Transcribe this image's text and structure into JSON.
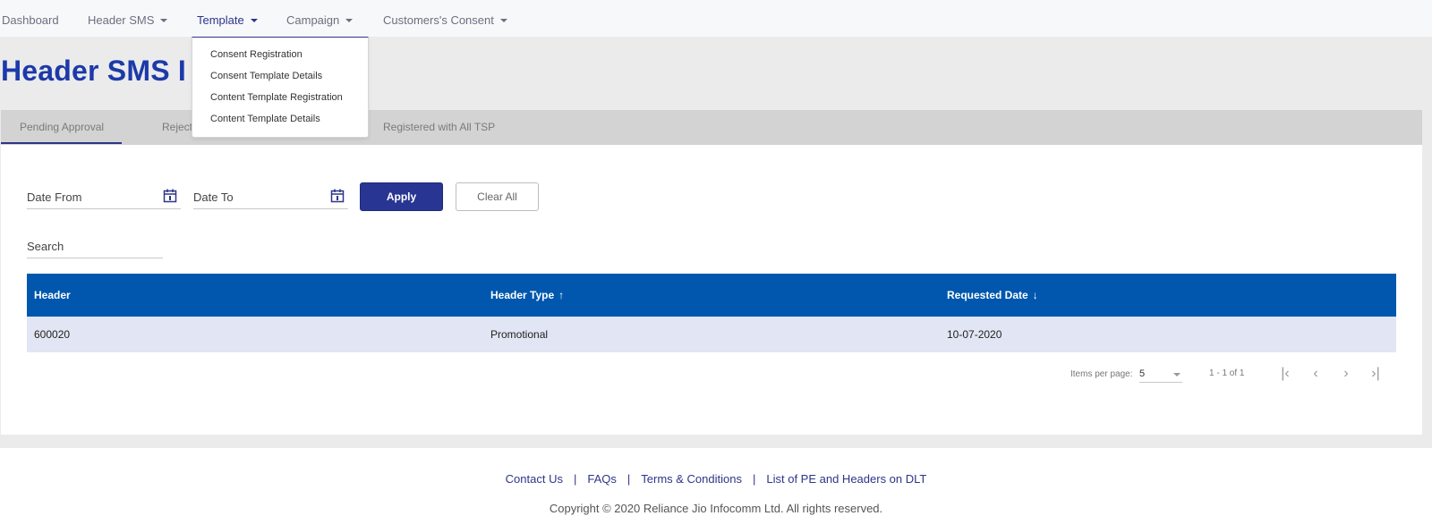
{
  "nav": {
    "items": [
      {
        "label": "Dashboard"
      },
      {
        "label": "Header SMS"
      },
      {
        "label": "Template"
      },
      {
        "label": "Campaign"
      },
      {
        "label": "Customers's Consent"
      }
    ]
  },
  "dropdown": {
    "items": [
      {
        "label": "Consent Registration"
      },
      {
        "label": "Consent Template Details"
      },
      {
        "label": "Content Template Registration"
      },
      {
        "label": "Content Template Details"
      }
    ]
  },
  "page": {
    "title": "Header SMS I"
  },
  "tabs": [
    {
      "label": "Pending Approval"
    },
    {
      "label": "Reject"
    },
    {
      "label": "Registered with All TSP"
    }
  ],
  "filters": {
    "date_from": "Date From",
    "date_to": "Date To",
    "apply": "Apply",
    "clear_all": "Clear All",
    "search": "Search"
  },
  "table": {
    "columns": [
      {
        "label": "Header",
        "sort": ""
      },
      {
        "label": "Header Type",
        "sort": "↑"
      },
      {
        "label": "Requested Date",
        "sort": "↓"
      }
    ],
    "rows": [
      {
        "header": "600020",
        "header_type": "Promotional",
        "requested_date": "10-07-2020"
      }
    ]
  },
  "paginator": {
    "items_per_page_label": "Items per page:",
    "items_per_page": "5",
    "range": "1 - 1 of 1",
    "first": "|‹",
    "prev": "‹",
    "next": "›",
    "last": "›|"
  },
  "footer": {
    "links": [
      {
        "label": "Contact Us"
      },
      {
        "label": "FAQs"
      },
      {
        "label": "Terms & Conditions"
      },
      {
        "label": "List of PE and Headers on DLT"
      }
    ],
    "separator": "|",
    "copyright": "Copyright © 2020 Reliance Jio Infocomm Ltd. All rights reserved."
  },
  "colors": {
    "accent": "#2e3588",
    "title": "#1c3aa9",
    "table_header": "#0157ad",
    "row_bg": "#e2e5f3"
  }
}
